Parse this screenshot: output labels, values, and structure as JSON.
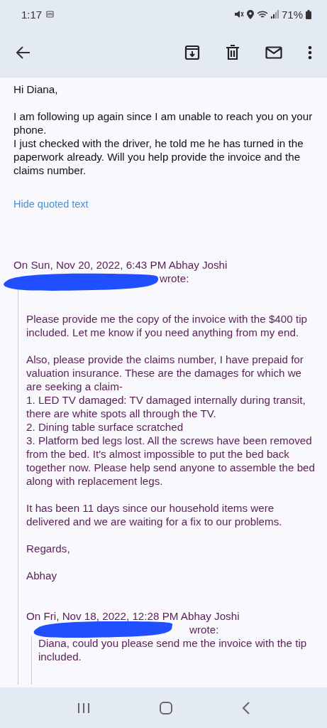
{
  "status_bar": {
    "time": "1:17",
    "battery": "71%"
  },
  "message": {
    "greeting": "Hi Diana,",
    "paragraphs": [
      [
        "I am following up again since I am unable to reach you on your phone.",
        "I just checked with the driver, he told me he has turned in the paperwork already. Will you help provide the invoice and the claims number."
      ]
    ]
  },
  "hide_quoted": "Hide quoted text",
  "quote": {
    "header": "On Sun, Nov 20, 2022, 6:43 PM Abhay Joshi",
    "wrote": "wrote:",
    "paragraphs": [
      [
        "Please provide me the copy of the invoice with the $400 tip included. Let me know if you need anything from my end."
      ],
      [
        "Also, please provide the claims number, I have prepaid for valuation insurance. These are the damages for which we are seeking a claim-",
        "1. LED TV damaged: TV damaged internally during transit, there are white spots all through the TV.",
        "2. Dining table surface scratched",
        "3. Platform bed legs lost. All the screws have been removed from the bed. It's almost impossible to put the bed back together now. Please help send anyone to assemble the bed along with replacement legs."
      ],
      [
        "It has been 11 days since our household items were delivered and we are waiting for a fix to our problems."
      ],
      [
        "Regards,"
      ],
      [
        "Abhay"
      ]
    ],
    "nested": {
      "header": "On Fri, Nov 18, 2022, 12:28 PM Abhay Joshi",
      "wrote": "wrote:",
      "text": "Diana, could you please send me the invoice with the tip included."
    }
  }
}
